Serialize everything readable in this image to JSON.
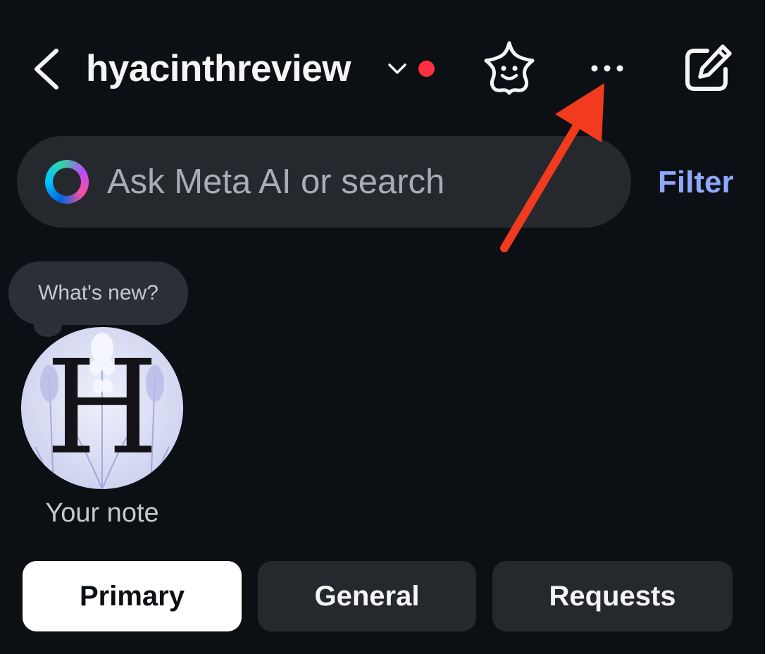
{
  "header": {
    "title": "hyacinthreview",
    "icons": {
      "back": "chevron-left-icon",
      "switch_account": "chevron-down-icon",
      "notification": "red-dot",
      "ai_studio": "ai-face-sparkle-icon",
      "more": "more-horizontal-icon",
      "compose": "compose-icon"
    }
  },
  "search": {
    "placeholder": "Ask Meta AI or search",
    "icon": "meta-ai-ring-icon"
  },
  "filter_label": "Filter",
  "note": {
    "bubble_text": "What's new?",
    "avatar_letter": "H",
    "label": "Your note"
  },
  "tabs": [
    {
      "label": "Primary",
      "selected": true
    },
    {
      "label": "General",
      "selected": false
    },
    {
      "label": "Requests",
      "selected": false
    }
  ],
  "colors": {
    "background": "#0c1014",
    "notification_dot": "#ff3040",
    "filter_link": "#8fa8ff",
    "annotation_arrow": "#f23a1e"
  }
}
